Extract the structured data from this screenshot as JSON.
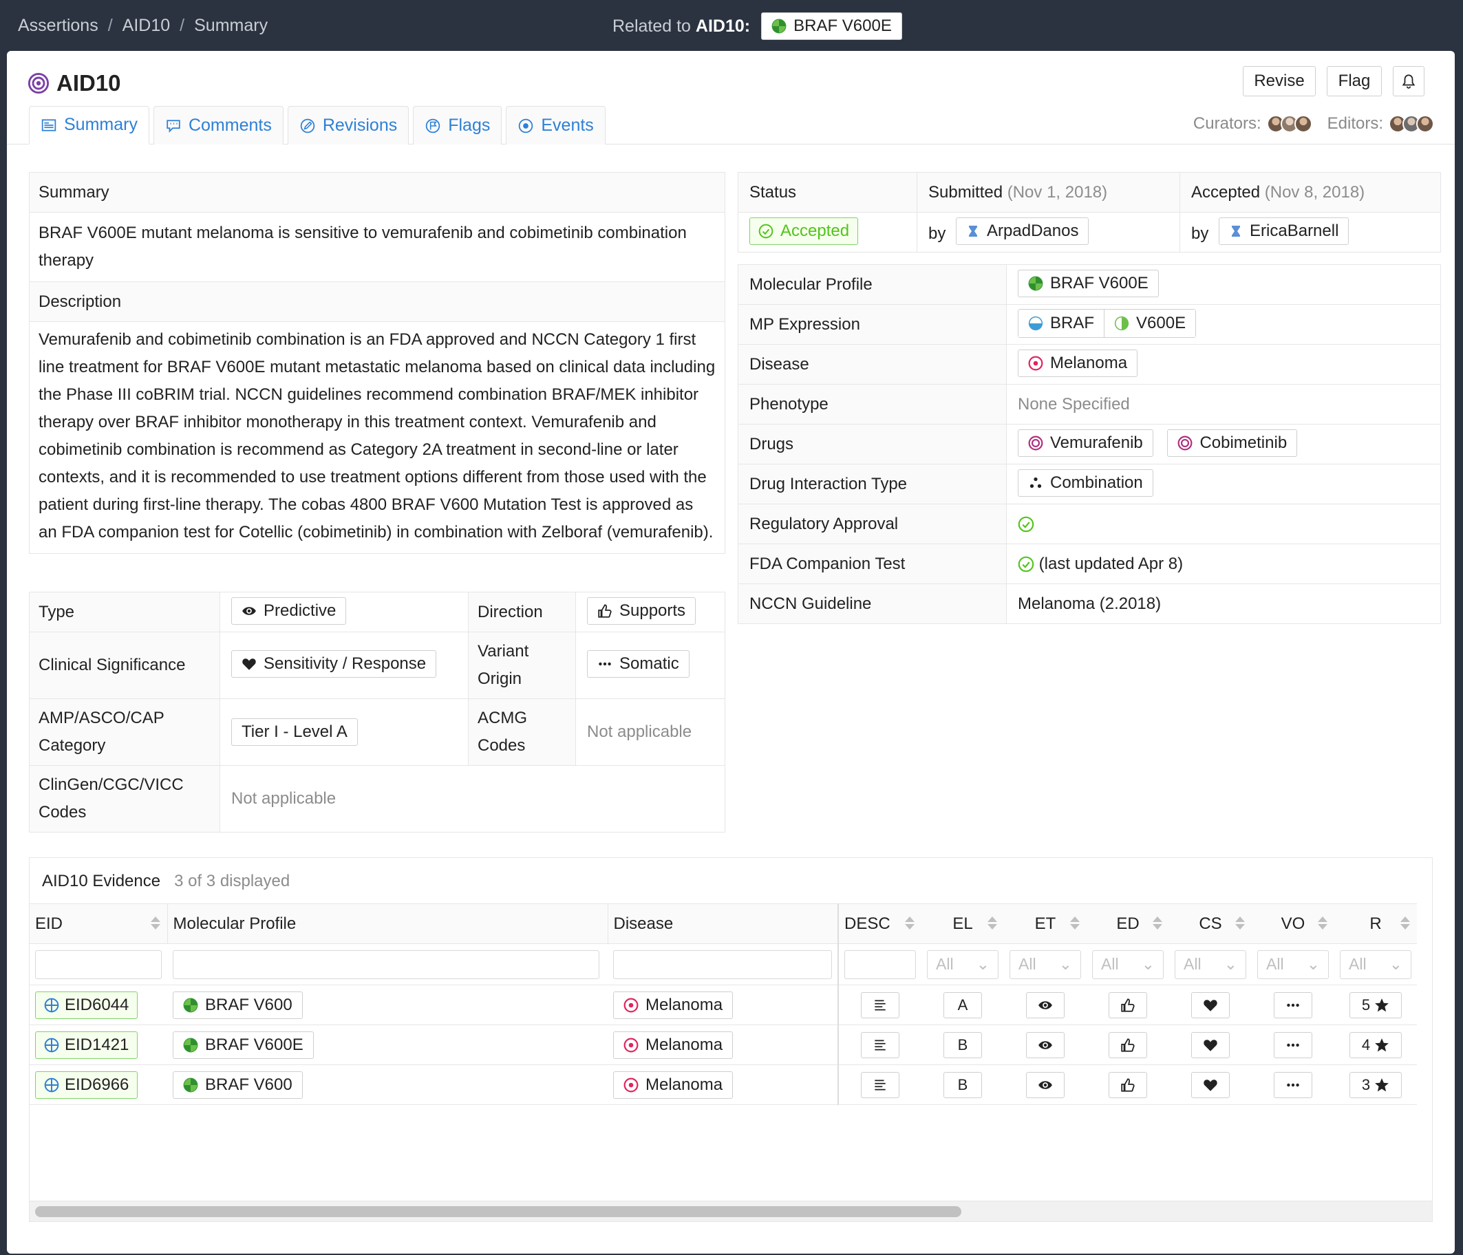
{
  "breadcrumb": {
    "items": [
      "Assertions",
      "AID10",
      "Summary"
    ],
    "sep": "/"
  },
  "related": {
    "prefix": "Related to",
    "id": "AID10:",
    "tag": "BRAF V600E"
  },
  "header": {
    "title": "AID10",
    "buttons": {
      "revise": "Revise",
      "flag": "Flag"
    }
  },
  "tabs": [
    {
      "label": "Summary",
      "icon": "summary-icon"
    },
    {
      "label": "Comments",
      "icon": "comment-icon"
    },
    {
      "label": "Revisions",
      "icon": "edit-icon"
    },
    {
      "label": "Flags",
      "icon": "flag-icon"
    },
    {
      "label": "Events",
      "icon": "events-icon"
    }
  ],
  "people": {
    "curators": "Curators:",
    "editors": "Editors:"
  },
  "summary": {
    "summary_label": "Summary",
    "summary_text": "BRAF V600E mutant melanoma is sensitive to vemurafenib and cobimetinib combination therapy",
    "description_label": "Description",
    "description_text": "Vemurafenib and cobimetinib combination is an FDA approved and NCCN Category 1 first line treatment for BRAF V600E mutant metastatic melanoma based on clinical data including the Phase III coBRIM trial. NCCN guidelines recommend combination BRAF/MEK inhibitor therapy over BRAF inhibitor monotherapy in this treatment context. Vemurafenib and cobimetinib combination is recommend as Category 2A treatment in second-line or later contexts, and it is recommended to use treatment options different from those used with the patient during first-line therapy. The cobas 4800 BRAF V600 Mutation Test is approved as an FDA companion test for Cotellic (cobimetinib) in combination with Zelboraf (vemurafenib)."
  },
  "attributes": {
    "type_label": "Type",
    "type_value": "Predictive",
    "direction_label": "Direction",
    "direction_value": "Supports",
    "clinsig_label": "Clinical Significance",
    "clinsig_value": "Sensitivity / Response",
    "origin_label": "Variant Origin",
    "origin_value": "Somatic",
    "amp_label": "AMP/ASCO/CAP Category",
    "amp_value": "Tier I - Level A",
    "acmg_label": "ACMG Codes",
    "acmg_value": "Not applicable",
    "clingen_label": "ClinGen/CGC/VICC Codes",
    "clingen_value": "Not applicable"
  },
  "status": {
    "status_label": "Status",
    "status_value": "Accepted",
    "submitted_label": "Submitted",
    "submitted_date": "(Nov 1, 2018)",
    "submitted_by": "by",
    "submitted_user": "ArpadDanos",
    "accepted_label": "Accepted",
    "accepted_date": "(Nov 8, 2018)",
    "accepted_by": "by",
    "accepted_user": "EricaBarnell"
  },
  "details": {
    "mp_label": "Molecular Profile",
    "mp_value": "BRAF V600E",
    "mpexpr_label": "MP Expression",
    "mpexpr_gene": "BRAF",
    "mpexpr_variant": "V600E",
    "disease_label": "Disease",
    "disease_value": "Melanoma",
    "phenotype_label": "Phenotype",
    "phenotype_value": "None Specified",
    "drugs_label": "Drugs",
    "drug1": "Vemurafenib",
    "drug2": "Cobimetinib",
    "interaction_label": "Drug Interaction Type",
    "interaction_value": "Combination",
    "regulatory_label": "Regulatory Approval",
    "fda_label": "FDA Companion Test",
    "fda_value": "(last updated Apr 8)",
    "nccn_label": "NCCN Guideline",
    "nccn_value": "Melanoma (2.2018)"
  },
  "evidence": {
    "title": "AID10 Evidence",
    "count": "3 of 3 displayed",
    "columns": [
      "EID",
      "Molecular Profile",
      "Disease",
      "DESC",
      "EL",
      "ET",
      "ED",
      "CS",
      "VO",
      "R"
    ],
    "filter_all": "All",
    "rows": [
      {
        "eid": "EID6044",
        "mp": "BRAF V600",
        "disease": "Melanoma",
        "el": "A",
        "rating": "5"
      },
      {
        "eid": "EID1421",
        "mp": "BRAF V600E",
        "disease": "Melanoma",
        "el": "B",
        "rating": "4"
      },
      {
        "eid": "EID6966",
        "mp": "BRAF V600",
        "disease": "Melanoma",
        "el": "B",
        "rating": "3"
      }
    ]
  },
  "colors": {
    "accent": "#2d80d6",
    "success": "#52c41a",
    "disease": "#e0245e",
    "drug": "#b0307e",
    "assertion": "#7b3fa8"
  }
}
